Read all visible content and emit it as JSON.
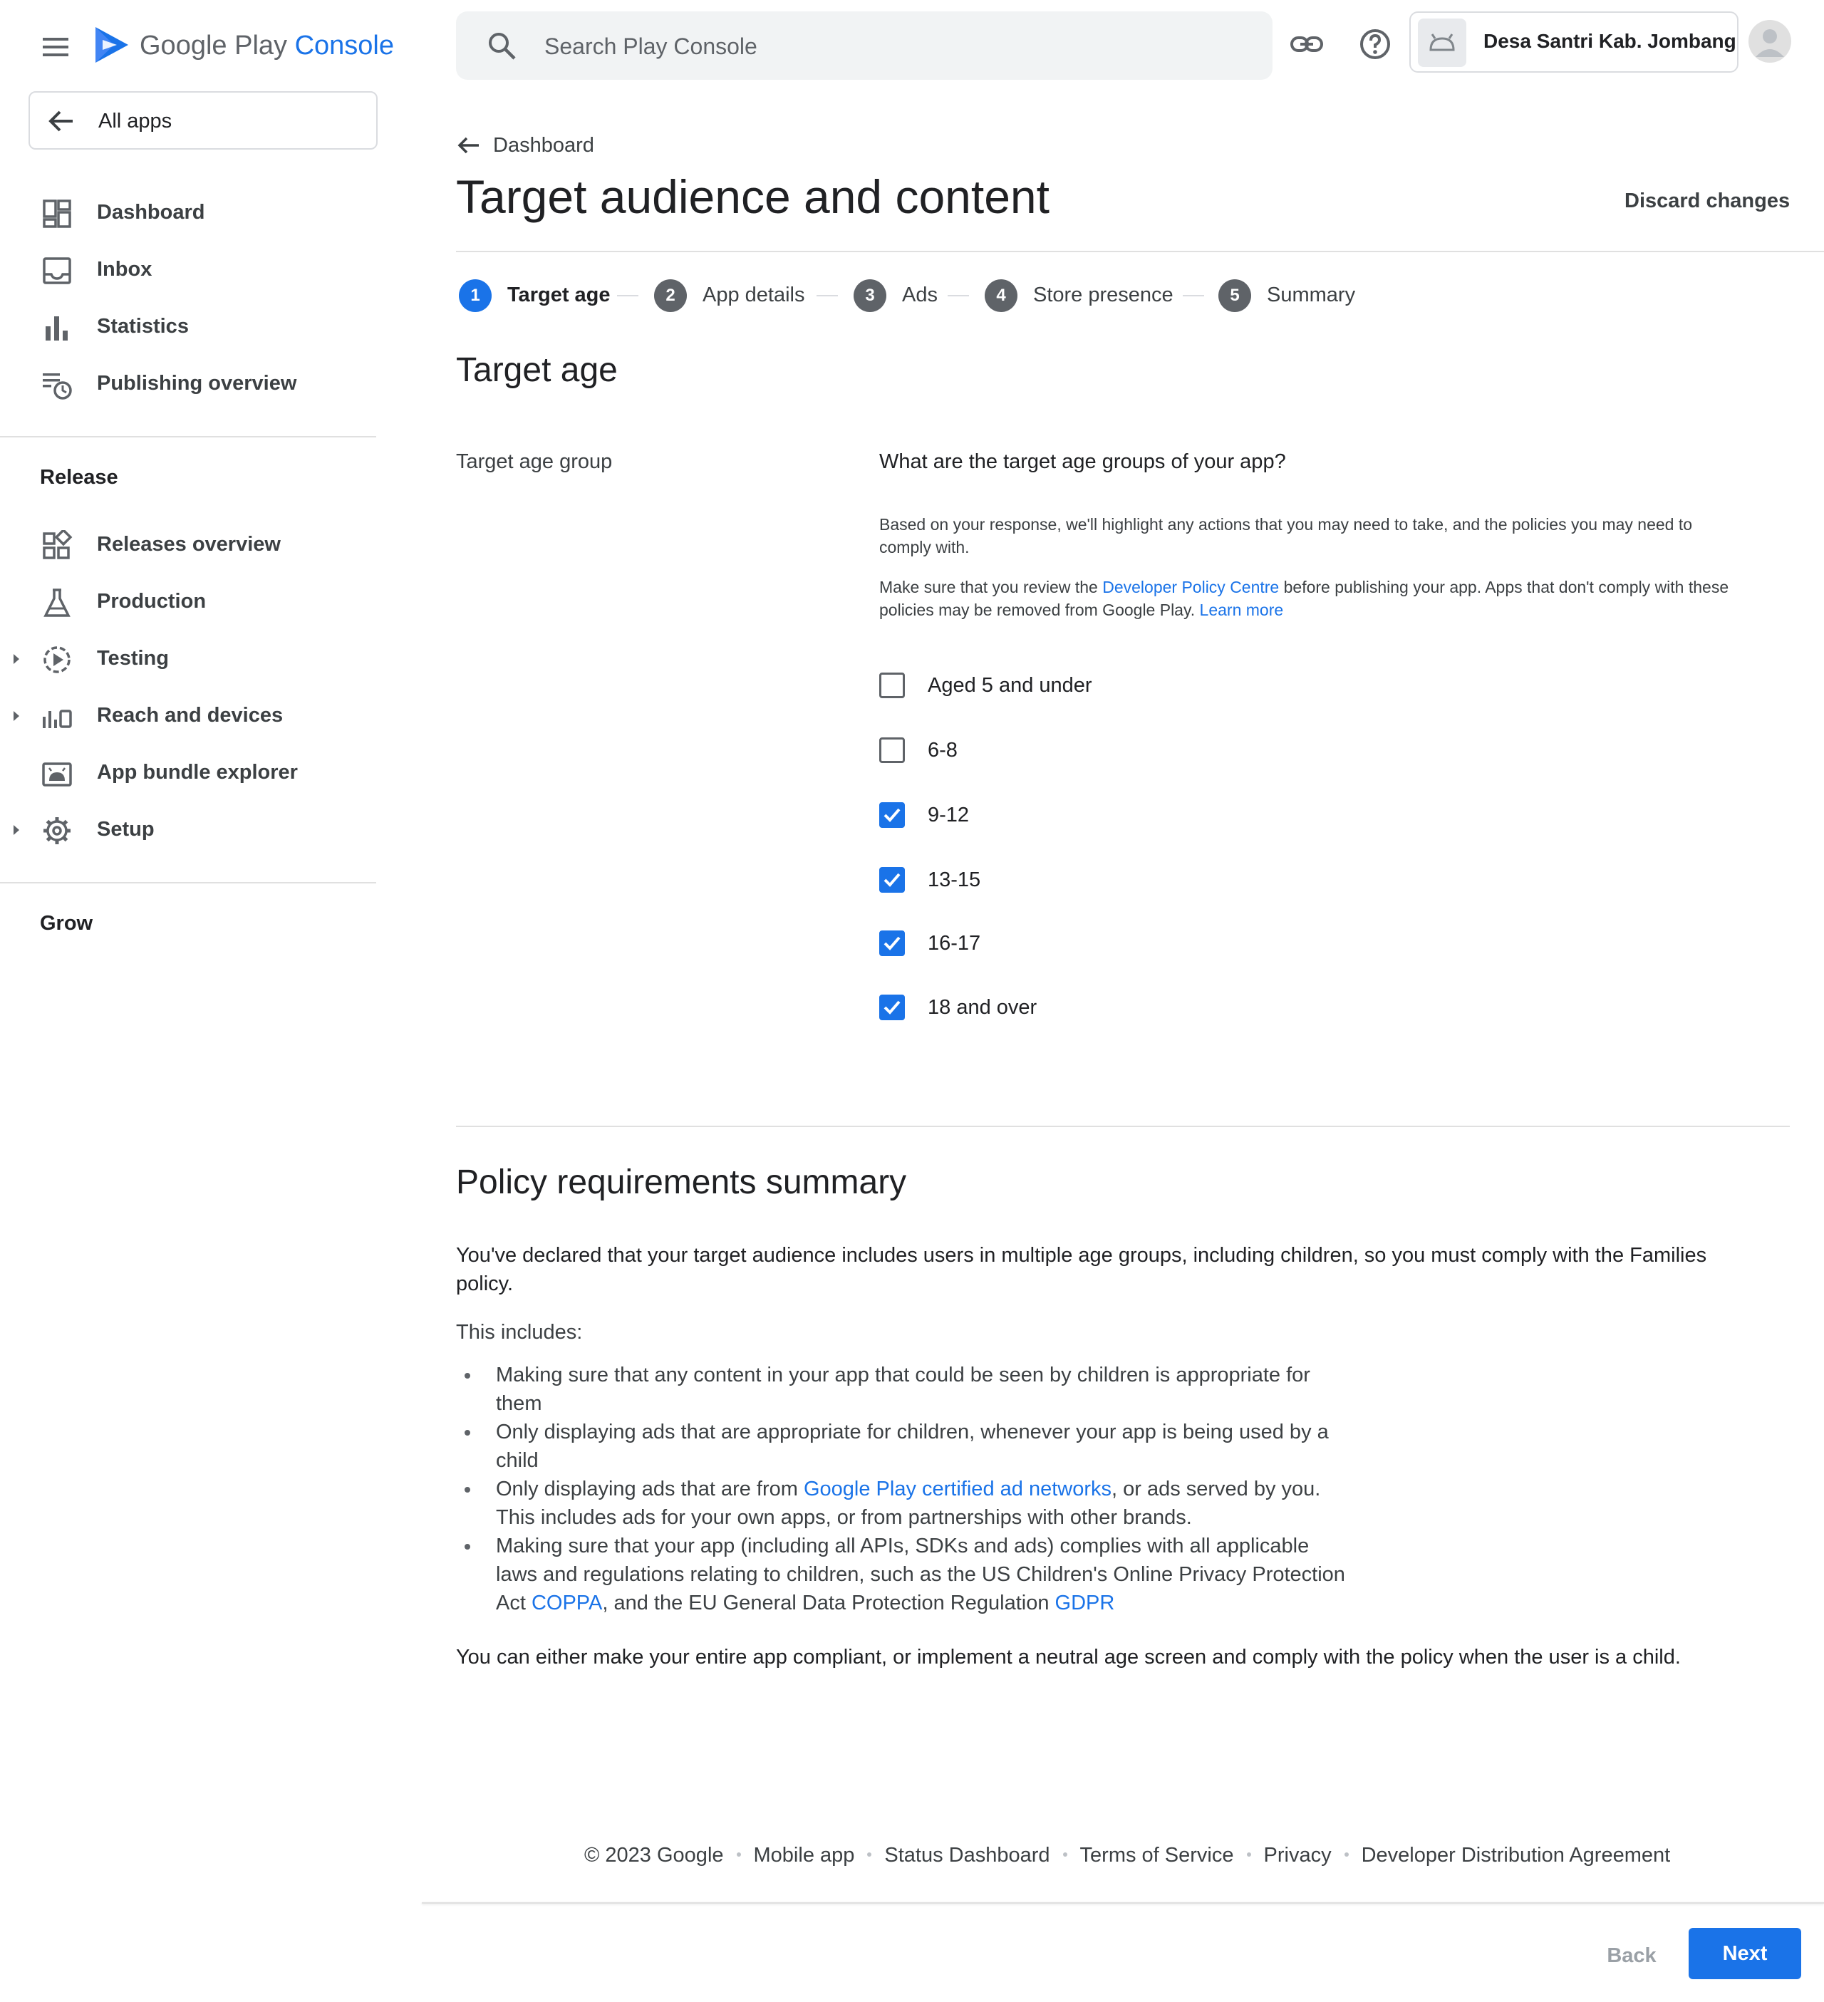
{
  "brand": {
    "google_play": "Google Play",
    "console": "Console"
  },
  "nav": {
    "all_apps": "All apps",
    "top_items": [
      {
        "label": "Dashboard",
        "icon": "dashboard-icon"
      },
      {
        "label": "Inbox",
        "icon": "inbox-icon"
      },
      {
        "label": "Statistics",
        "icon": "bar-chart-icon"
      },
      {
        "label": "Publishing overview",
        "icon": "publishing-schedule-icon"
      }
    ],
    "release_section": "Release",
    "release_items": [
      {
        "label": "Releases overview",
        "icon": "releases-grid-icon",
        "expandable": false
      },
      {
        "label": "Production",
        "icon": "production-flask-icon",
        "expandable": false
      },
      {
        "label": "Testing",
        "icon": "testing-play-icon",
        "expandable": true
      },
      {
        "label": "Reach and devices",
        "icon": "reach-devices-icon",
        "expandable": true
      },
      {
        "label": "App bundle explorer",
        "icon": "android-bundle-icon",
        "expandable": false
      },
      {
        "label": "Setup",
        "icon": "settings-gear-icon",
        "expandable": true
      }
    ],
    "grow_section": "Grow"
  },
  "topbar": {
    "search_placeholder": "Search Play Console",
    "account_name": "Desa Santri Kab. Jombang"
  },
  "page": {
    "breadcrumb": "Dashboard",
    "title": "Target audience and content",
    "discard": "Discard changes"
  },
  "steps": [
    {
      "num": "1",
      "label": "Target age",
      "active": true
    },
    {
      "num": "2",
      "label": "App details",
      "active": false
    },
    {
      "num": "3",
      "label": "Ads",
      "active": false
    },
    {
      "num": "4",
      "label": "Store presence",
      "active": false
    },
    {
      "num": "5",
      "label": "Summary",
      "active": false
    }
  ],
  "target_age": {
    "section_title": "Target age",
    "field_label": "Target age group",
    "question": "What are the target age groups of your app?",
    "help1": "Based on your response, we'll highlight any actions that you may need to take, and the policies you may need to comply with.",
    "help2_pre": "Make sure that you review the ",
    "help2_link": "Developer Policy Centre",
    "help2_mid": " before publishing your app. Apps that don't comply with these policies may be removed from Google Play. ",
    "help2_learn": "Learn more",
    "options": [
      {
        "label": "Aged 5 and under",
        "checked": false
      },
      {
        "label": "6-8",
        "checked": false
      },
      {
        "label": "9-12",
        "checked": true
      },
      {
        "label": "13-15",
        "checked": true
      },
      {
        "label": "16-17",
        "checked": true
      },
      {
        "label": "18 and over",
        "checked": true
      }
    ]
  },
  "policy": {
    "title": "Policy requirements summary",
    "intro": "You've declared that your target audience includes users in multiple age groups, including children, so you must comply with the Families policy.",
    "includes": "This includes:",
    "b1": "Making sure that any content in your app that could be seen by children is appropriate for them",
    "b2": "Only displaying ads that are appropriate for children, whenever your app is being used by a child",
    "b3_pre": "Only displaying ads that are from ",
    "b3_link": "Google Play certified ad networks",
    "b3_post": ", or ads served by you. This includes ads for your own apps, or from partnerships with other brands.",
    "b4_pre": "Making sure that your app (including all APIs, SDKs and ads) complies with all applicable laws and regulations relating to children, such as the US Children's Online Privacy Protection Act ",
    "b4_link1": "COPPA",
    "b4_mid": ", and the EU General Data Protection Regulation ",
    "b4_link2": "GDPR",
    "closing": "You can either make your entire app compliant, or implement a neutral age screen and comply with the policy when the user is a child."
  },
  "footer": {
    "copyright": "© 2023 Google",
    "mobile_app": "Mobile app",
    "status": "Status Dashboard",
    "terms": "Terms of Service",
    "privacy": "Privacy",
    "dda": "Developer Distribution Agreement"
  },
  "actions": {
    "back": "Back",
    "next": "Next"
  },
  "colors": {
    "accent": "#1a73e8",
    "text": "#202124",
    "secondary": "#3c4043",
    "step_inactive": "#5f6368"
  }
}
